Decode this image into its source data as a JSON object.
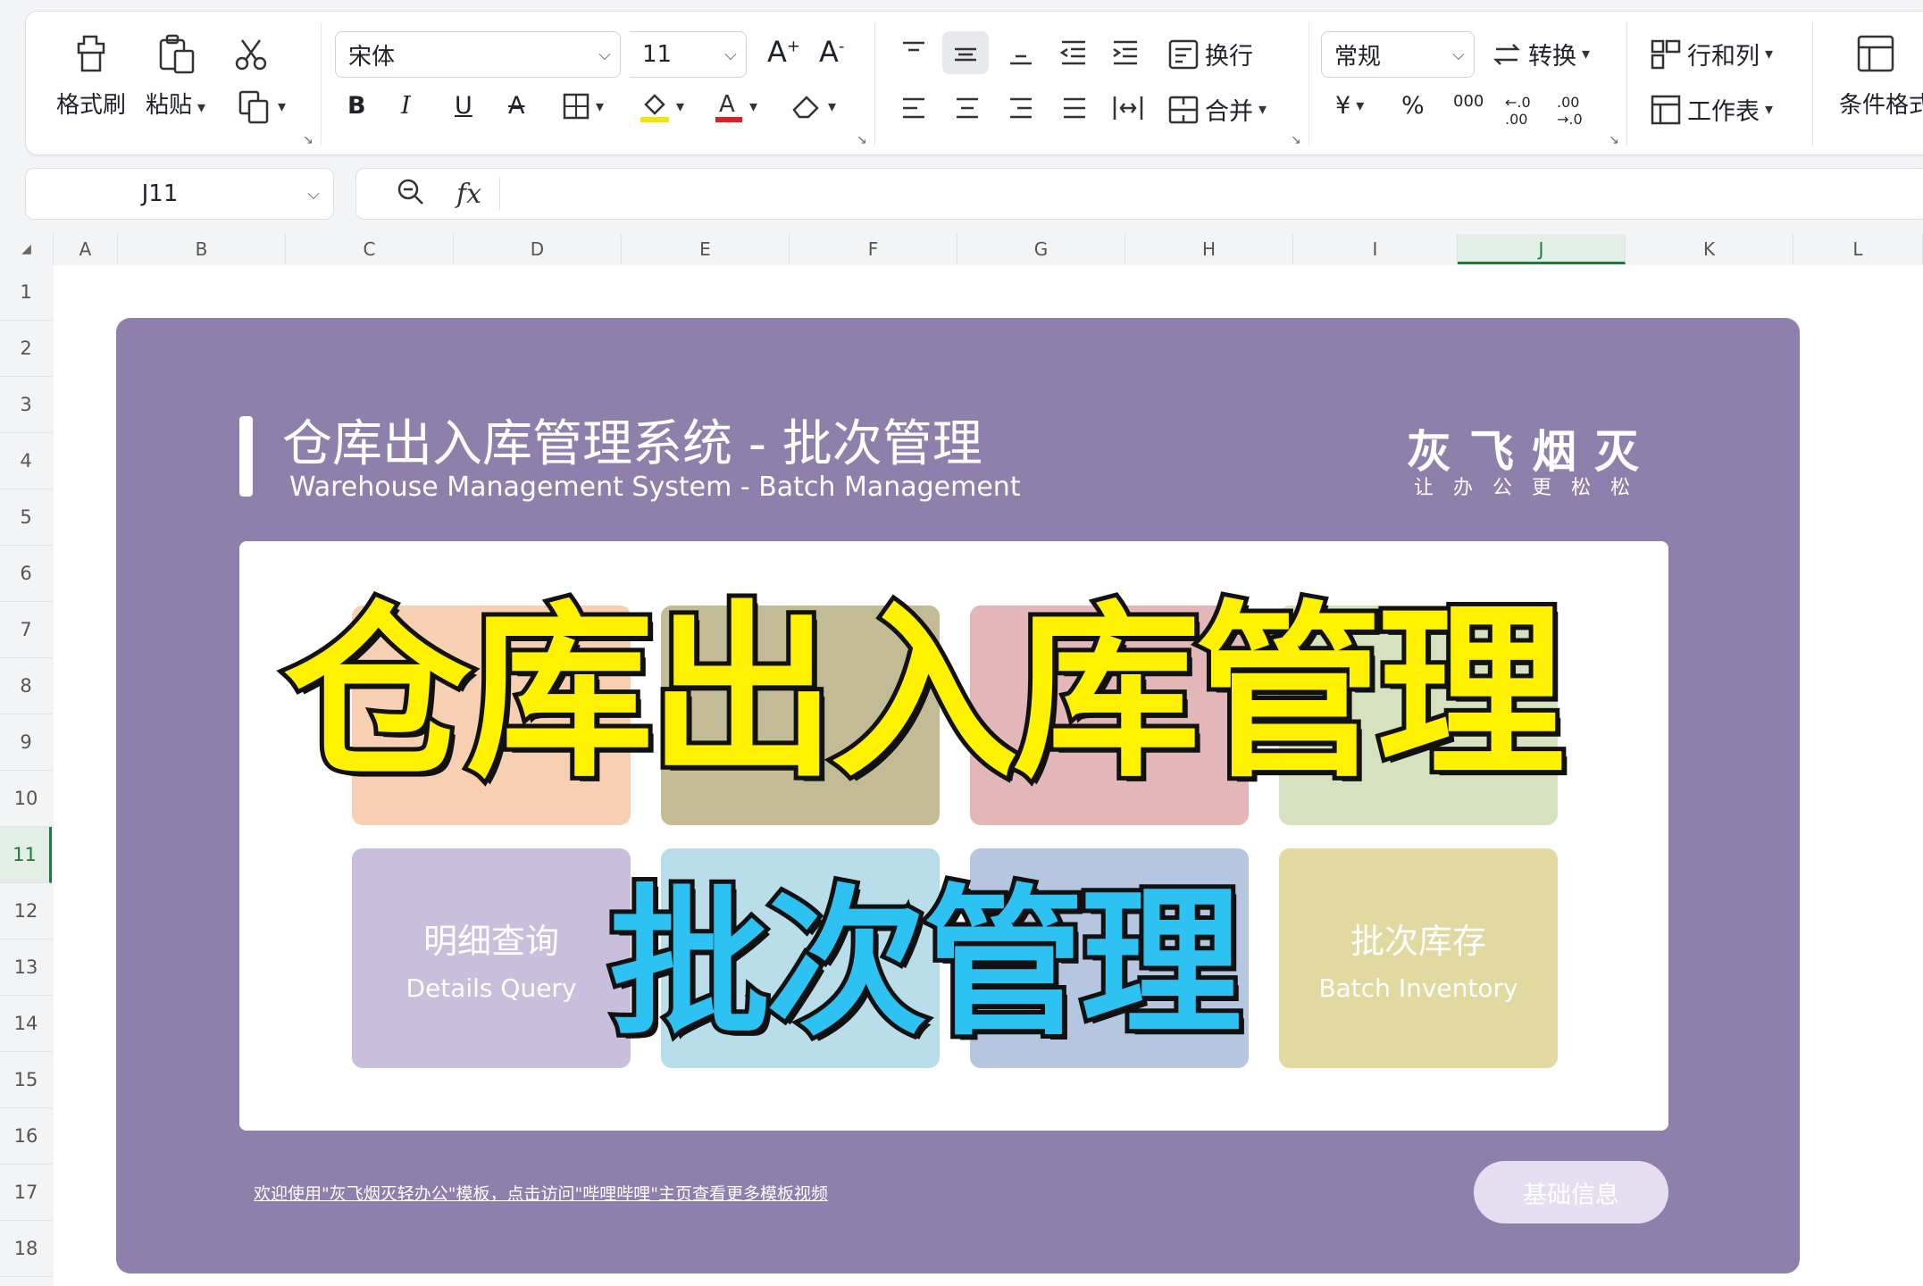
{
  "ribbon": {
    "format_painter": "格式刷",
    "paste": "粘贴",
    "font_name": "宋体",
    "font_size": "11",
    "wrap": "换行",
    "merge": "合并",
    "number_format": "常规",
    "convert": "转换",
    "row_col": "行和列",
    "worksheet": "工作表",
    "cond_format": "条件格式",
    "bold": "B",
    "italic": "I",
    "underline": "U",
    "currency": "¥",
    "percent": "%",
    "thousands": "000"
  },
  "formula_bar": {
    "cell_ref": "J11",
    "fx": "fx",
    "value": ""
  },
  "grid": {
    "columns": [
      "A",
      "B",
      "C",
      "D",
      "E",
      "F",
      "G",
      "H",
      "I",
      "J",
      "K",
      "L"
    ],
    "rows": [
      "1",
      "2",
      "3",
      "4",
      "5",
      "6",
      "7",
      "8",
      "9",
      "10",
      "11",
      "12",
      "13",
      "14",
      "15",
      "16",
      "17",
      "18"
    ],
    "selected_col": "J",
    "selected_row": "11"
  },
  "panel": {
    "title": "仓库出入库管理系统 - 批次管理",
    "subtitle": "Warehouse Management System - Batch Management",
    "brand": "灰飞烟灭",
    "brand_tagline": "让办公更松松",
    "tiles_row1": [
      {
        "cn": "",
        "en": "",
        "color": "#f7d0b4"
      },
      {
        "cn": "",
        "en": "",
        "color": "#c3bb96"
      },
      {
        "cn": "",
        "en": "",
        "color": "#e3b6b7"
      },
      {
        "cn": "",
        "en": "",
        "color": "#d6e1c0"
      }
    ],
    "tiles_row2": [
      {
        "cn": "明细查询",
        "en": "Details Query",
        "color": "#c9bfdc"
      },
      {
        "cn": "",
        "en": "",
        "color": "#b9dde9"
      },
      {
        "cn": "",
        "en": "",
        "color": "#b6c6e0"
      },
      {
        "cn": "批次库存",
        "en": "Batch Inventory",
        "color": "#e1d9a0"
      }
    ],
    "footer_link": "欢迎使用\"灰飞烟灭轻办公\"模板，点击访问\"哔哩哔哩\"主页查看更多模板视频",
    "base_button": "基础信息"
  },
  "overlay": {
    "main": "仓库出入库管理",
    "sub": "批次管理"
  },
  "colors": {
    "panel": "#8e7fab",
    "overlay_main": "#fff200",
    "overlay_sub": "#2ec2f3",
    "selection": "#1e7a3a"
  }
}
